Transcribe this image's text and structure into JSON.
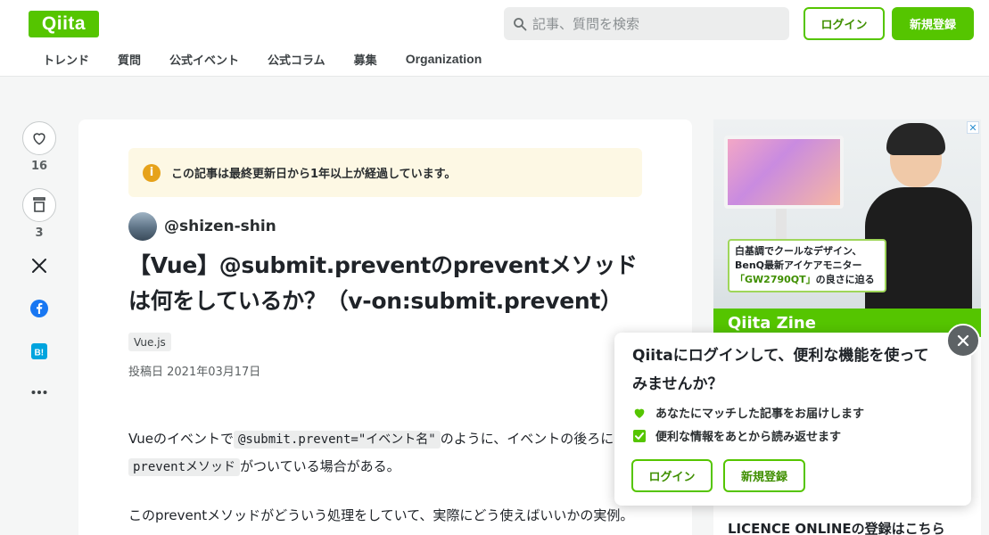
{
  "header": {
    "logo": "Qiita",
    "search_placeholder": "記事、質問を検索",
    "login_label": "ログイン",
    "signup_label": "新規登録",
    "nav": [
      "トレンド",
      "質問",
      "公式イベント",
      "公式コラム",
      "募集",
      "Organization"
    ]
  },
  "social": {
    "like_count": "16",
    "stock_count": "3"
  },
  "article": {
    "notice": "この記事は最終更新日から1年以上が経過しています。",
    "notice_icon": "i",
    "author": "@shizen-shin",
    "title": "【Vue】@submit.preventのpreventメソッドは何をしているか？（v-on:submit.prevent）",
    "tag": "Vue.js",
    "posted": "投稿日 2021年03月17日",
    "p1_before": "Vueのイベントで",
    "p1_code1": "@submit.prevent=\"イベント名\"",
    "p1_mid": "のように、イベントの後ろに",
    "p1_code2": "preventメソッド",
    "p1_after": "がついている場合がある。",
    "p2": "このpreventメソッドがどういう処理をしていて、実際にどう使えばいいかの実例。"
  },
  "ad": {
    "caption_line1": "白基調でクールなデザイン、",
    "caption_line2": "BenQ最新アイケアモニター",
    "caption_highlight": "「GW2790QT」",
    "caption_tail": "の良さに迫る",
    "close_mark": "✕",
    "zine": "Qiita Zine",
    "licence": "LICENCE ONLINEの登録はこちら"
  },
  "popup": {
    "title": "Qiitaにログインして、便利な機能を使ってみませんか？",
    "feature1": "あなたにマッチした記事をお届けします",
    "feature2": "便利な情報をあとから読み返せます",
    "login_label": "ログイン",
    "signup_label": "新規登録"
  },
  "colors": {
    "brand": "#55c500",
    "notice_bg": "#fdf8e4",
    "notice_icon": "#e6a21a",
    "facebook": "#1877f2",
    "hatena": "#00a4de"
  },
  "icons": [
    "search-icon",
    "heart-icon",
    "stock-icon",
    "x-icon",
    "facebook-icon",
    "hatena-bookmark-icon",
    "more-icon",
    "info-icon",
    "close-icon",
    "heart-feature-icon",
    "check-feature-icon"
  ]
}
